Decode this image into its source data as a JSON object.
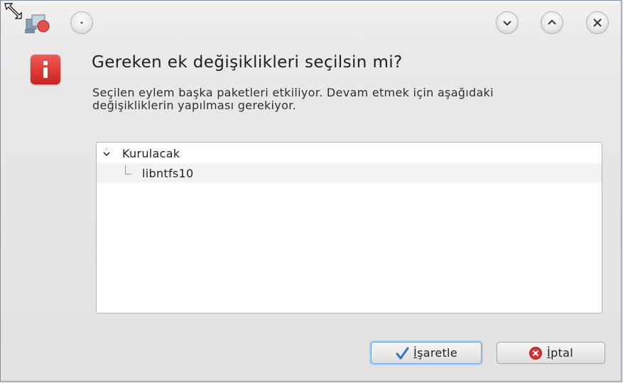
{
  "window": {
    "title_buttons": {
      "menu": "circle-dot-icon",
      "minimize": "chevron-down-icon",
      "maximize": "chevron-up-icon",
      "close": "close-icon"
    }
  },
  "dialog": {
    "icon": "info-icon",
    "icon_glyph": "i",
    "heading": "Gereken ek değişiklikleri seçilsin mi?",
    "description": "Seçilen eylem başka paketleri etkiliyor. Devam etmek için aşağıdaki değişikliklerin yapılması gerekiyor."
  },
  "tree": {
    "group_label": "Kurulacak",
    "expanded": true,
    "items": [
      {
        "label": "libntfs10"
      }
    ]
  },
  "buttons": {
    "confirm": {
      "label_mnemonic": "İ",
      "label_rest": "şaretle",
      "icon": "checkmark-icon"
    },
    "cancel": {
      "label_mnemonic": "İ",
      "label_rest": "ptal",
      "icon": "cancel-icon"
    }
  },
  "colors": {
    "accent": "#c9221f",
    "focus": "#6fa2d6"
  }
}
